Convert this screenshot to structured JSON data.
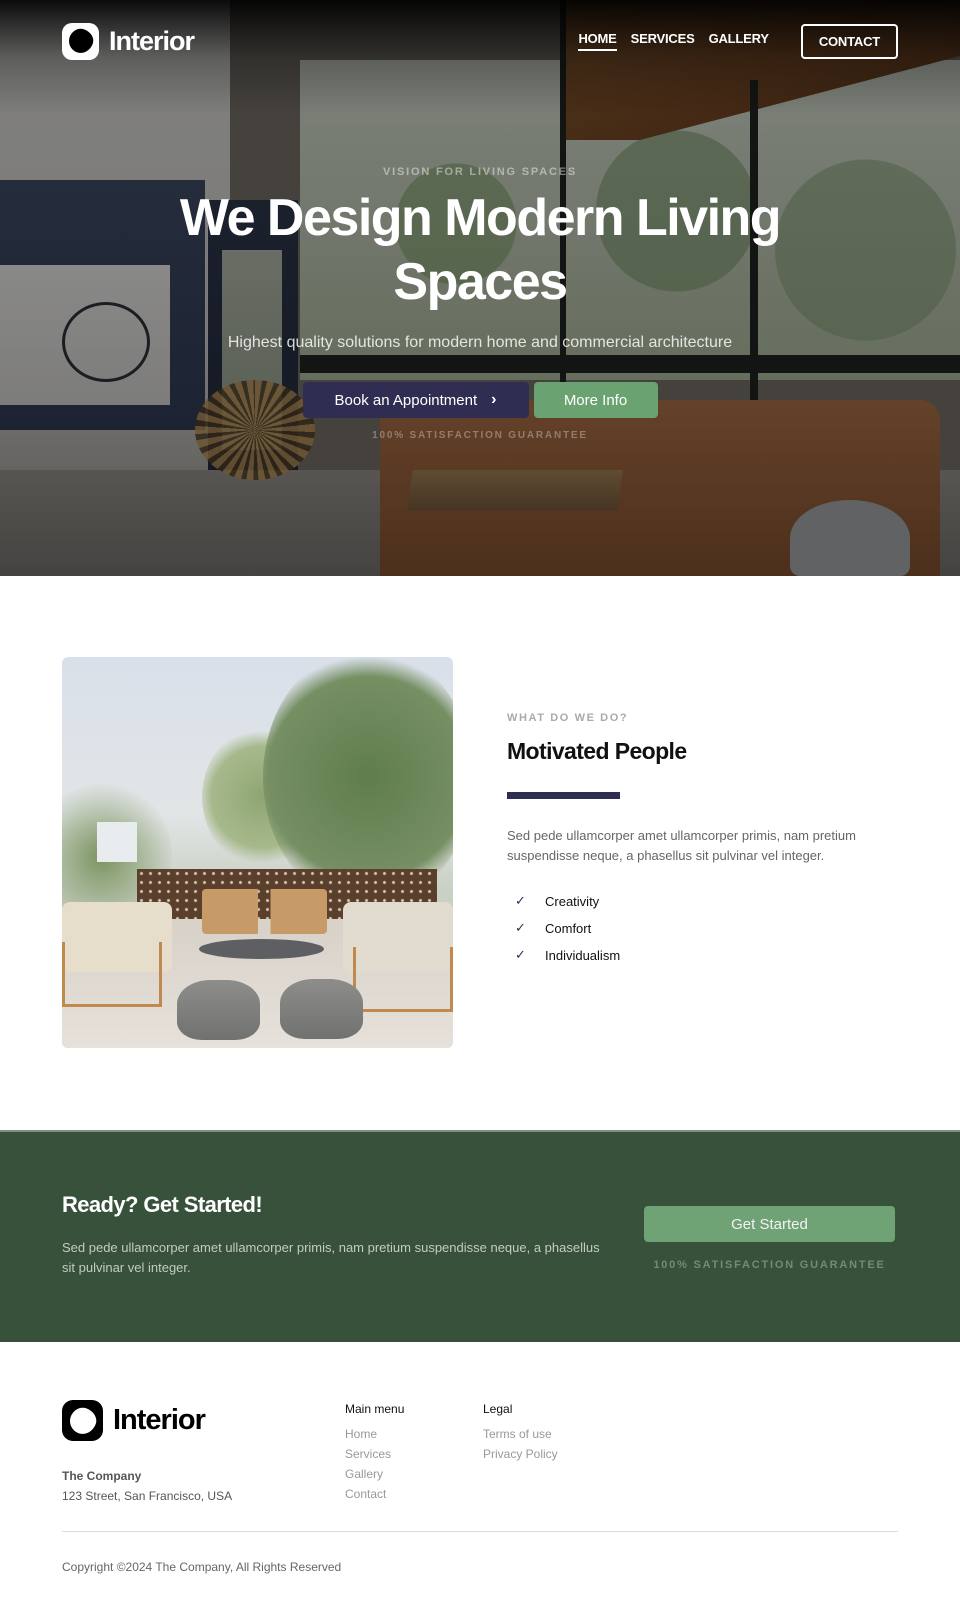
{
  "brand": {
    "name": "Interior",
    "logo_icon": "blob-logo-icon"
  },
  "nav": {
    "links": [
      {
        "label": "HOME",
        "active": true
      },
      {
        "label": "SERVICES",
        "active": false
      },
      {
        "label": "GALLERY",
        "active": false
      }
    ],
    "contact_label": "CONTACT"
  },
  "hero": {
    "eyebrow": "VISION FOR LIVING SPACES",
    "title": "We Design Modern Living Spaces",
    "subtitle": "Highest quality solutions for modern home and commercial architecture",
    "primary_button": "Book an Appointment",
    "primary_button_icon": "chevron-right-icon",
    "secondary_button": "More Info",
    "guarantee": "100% SATISFACTION GUARANTEE",
    "image_alt": "Modern living room interior with large windows"
  },
  "feature": {
    "image_alt": "Outdoor terrace lounge with sofas and poufs",
    "eyebrow": "WHAT DO WE DO?",
    "title": "Motivated People",
    "description": "Sed pede ullamcorper amet ullamcorper primis, nam pretium suspendisse neque, a phasellus sit pulvinar vel integer.",
    "checklist": [
      {
        "icon": "check-icon",
        "label": "Creativity"
      },
      {
        "icon": "check-icon",
        "label": "Comfort"
      },
      {
        "icon": "check-icon",
        "label": "Individualism"
      }
    ]
  },
  "cta": {
    "title": "Ready? Get Started!",
    "description": "Sed pede ullamcorper amet ullamcorper primis, nam pretium suspendisse neque, a phasellus sit pulvinar vel integer.",
    "button": "Get Started",
    "guarantee": "100% SATISFACTION GUARANTEE"
  },
  "footer": {
    "brand_name": "Interior",
    "company": "The Company",
    "address": "123 Street, San Francisco, USA",
    "columns": [
      {
        "title": "Main menu",
        "links": [
          "Home",
          "Services",
          "Gallery",
          "Contact"
        ]
      },
      {
        "title": "Legal",
        "links": [
          "Terms of use",
          "Privacy Policy"
        ]
      }
    ],
    "copyright": "Copyright ©2024 The Company, All Rights Reserved"
  },
  "colors": {
    "primary": "#2f2e52",
    "accent_green": "#6aa271",
    "cta_background": "#37513b",
    "text_muted": "#999999"
  }
}
